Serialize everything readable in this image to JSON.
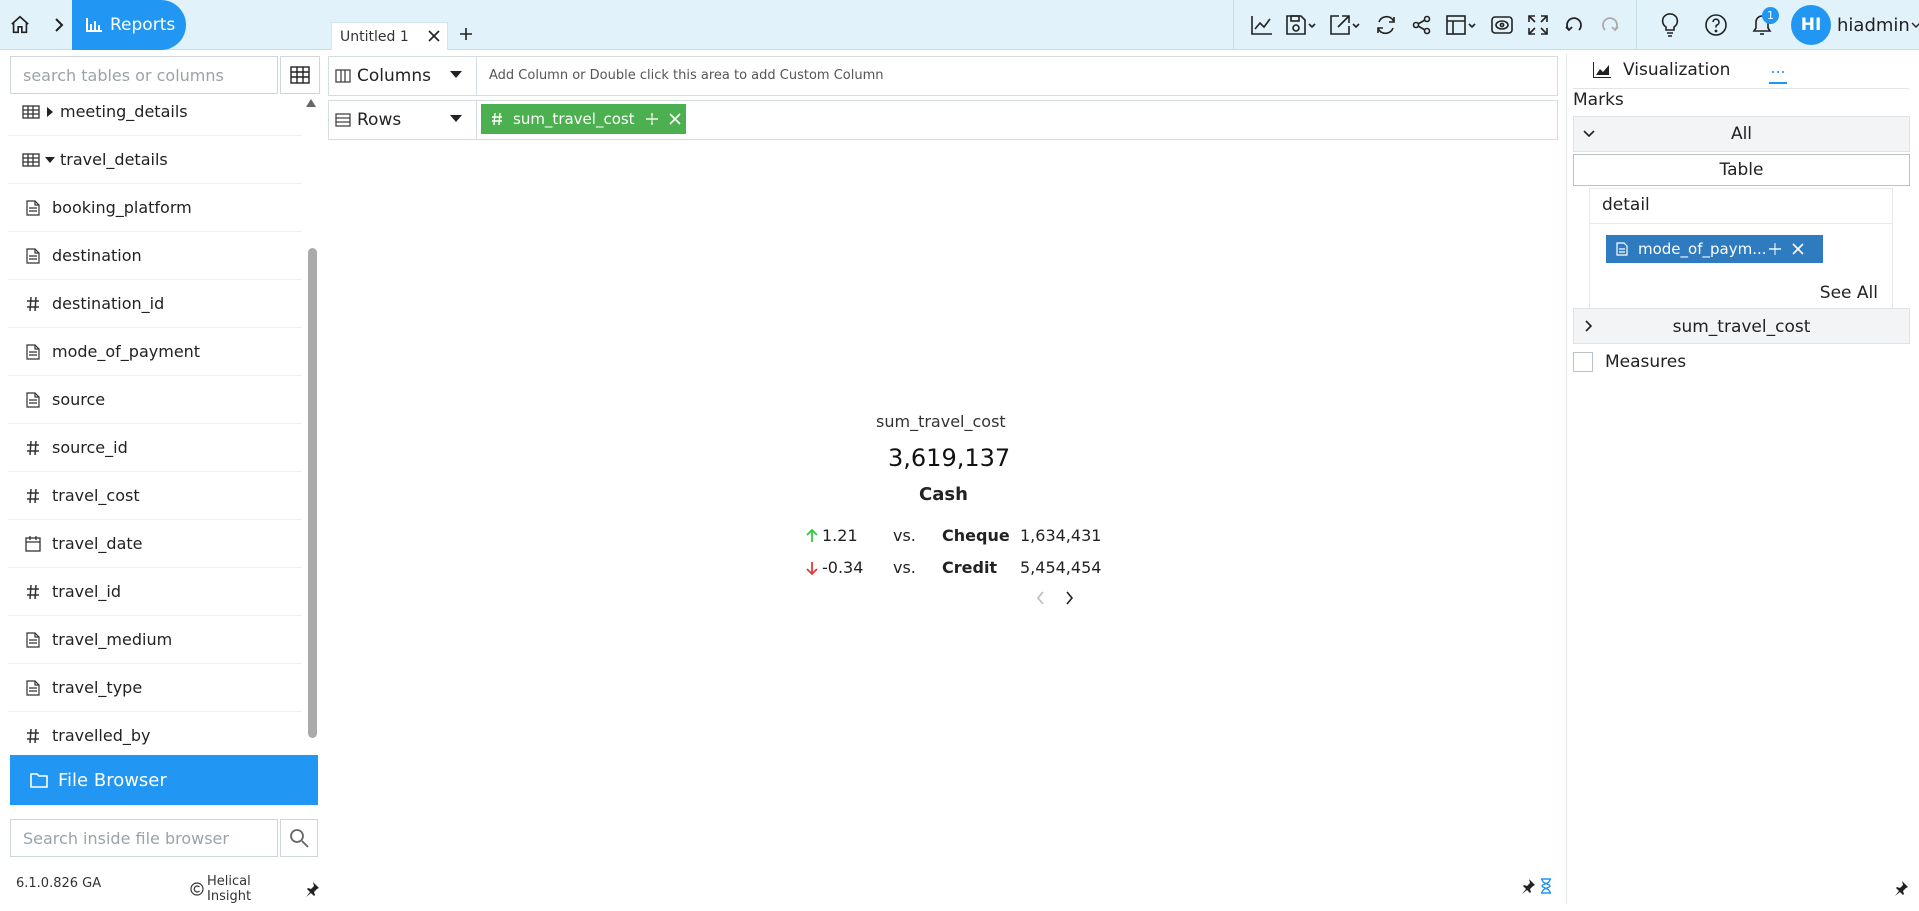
{
  "header": {
    "reports_label": "Reports",
    "tab_title": "Untitled 1",
    "notification_count": "1",
    "avatar_initials": "HI",
    "username": "hiadmin"
  },
  "left": {
    "search_placeholder": "search tables or columns",
    "tree": [
      {
        "icon": "table",
        "label": "meeting_details"
      },
      {
        "icon": "table",
        "label": "travel_details"
      },
      {
        "icon": "text",
        "label": "booking_platform"
      },
      {
        "icon": "text",
        "label": "destination"
      },
      {
        "icon": "hash",
        "label": "destination_id"
      },
      {
        "icon": "text",
        "label": "mode_of_payment"
      },
      {
        "icon": "text",
        "label": "source"
      },
      {
        "icon": "hash",
        "label": "source_id"
      },
      {
        "icon": "hash",
        "label": "travel_cost"
      },
      {
        "icon": "calendar",
        "label": "travel_date"
      },
      {
        "icon": "hash",
        "label": "travel_id"
      },
      {
        "icon": "text",
        "label": "travel_medium"
      },
      {
        "icon": "text",
        "label": "travel_type"
      },
      {
        "icon": "hash",
        "label": "travelled_by"
      }
    ],
    "file_browser_label": "File Browser",
    "file_browser_search_placeholder": "Search inside file browser",
    "version": "6.1.0.826 GA",
    "brand": "Helical Insight"
  },
  "shelves": {
    "columns_label": "Columns",
    "columns_hint": "Add Column or Double click this area to add Custom Column",
    "rows_label": "Rows",
    "row_field": "sum_travel_cost"
  },
  "kpi": {
    "label": "sum_travel_cost",
    "value": "3,619,137",
    "category": "Cash",
    "comparisons": [
      {
        "direction": "up",
        "delta": "1.21",
        "vs": "vs.",
        "category": "Cheque",
        "value": "1,634,431"
      },
      {
        "direction": "down",
        "delta": "-0.34",
        "vs": "vs.",
        "category": "Credit",
        "value": "5,454,454"
      }
    ]
  },
  "right": {
    "viz_tab": "Visualization",
    "more_tab": "...",
    "marks_label": "Marks",
    "marks_all": "All",
    "mark_type": "Table",
    "detail_label": "detail",
    "detail_field": "mode_of_paym...",
    "see_all": "See All",
    "sum_mark": "sum_travel_cost",
    "measures_label": "Measures"
  },
  "colors": {
    "accent": "#2196f3",
    "row_pill": "#4caf50",
    "detail_pill": "#2f7bbf",
    "up": "#2ecc40",
    "down": "#e53935"
  }
}
